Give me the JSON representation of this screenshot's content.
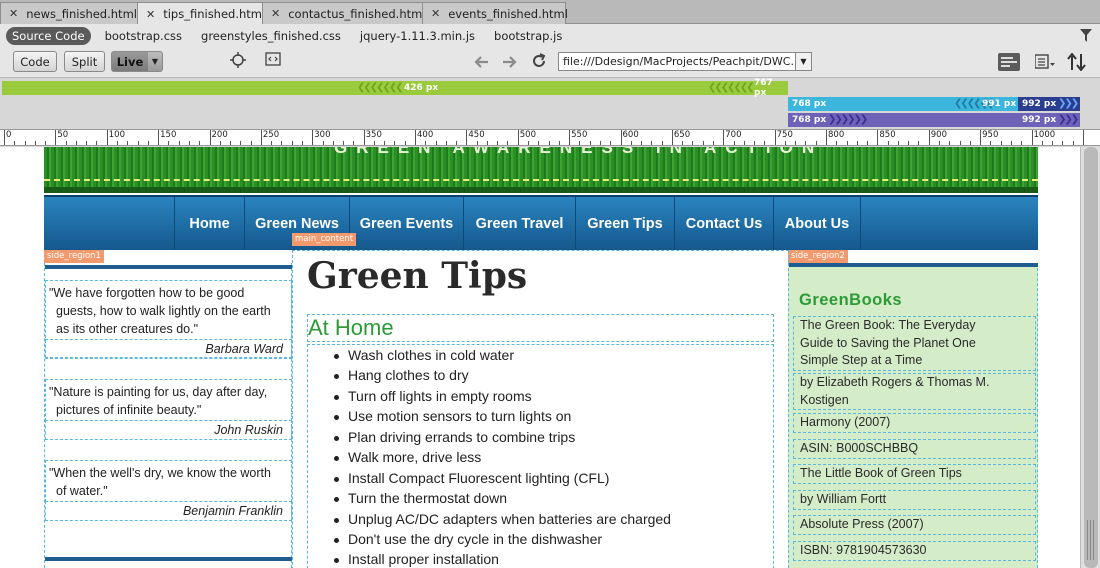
{
  "tabs": [
    {
      "label": "news_finished.html"
    },
    {
      "label": "tips_finished.html"
    },
    {
      "label": "contactus_finished.html"
    },
    {
      "label": "events_finished.html"
    }
  ],
  "related_files": {
    "source": "Source Code",
    "files": [
      "bootstrap.css",
      "greenstyles_finished.css",
      "jquery-1.11.3.min.js",
      "bootstrap.js"
    ]
  },
  "toolbar": {
    "code": "Code",
    "split": "Split",
    "live": "Live",
    "address": "file:///Ddesign/MacProjects/Peachpit/DWC..."
  },
  "media_queries": {
    "bar1_left": "426  px",
    "bar1_right": "767  px",
    "bar2_left": "768  px",
    "bar2_mid": "991  px",
    "bar2_right": "992  px",
    "bar3_left": "768  px",
    "bar3_right": "992  px"
  },
  "ruler": [
    "0",
    "50",
    "100",
    "150",
    "200",
    "250",
    "300",
    "350",
    "400",
    "450",
    "500",
    "550",
    "600",
    "650",
    "700",
    "750",
    "800",
    "850",
    "900",
    "950",
    "1000"
  ],
  "page": {
    "banner_title": "GREEN AWARENESS IN ACTION",
    "nav": [
      "Home",
      "Green News",
      "Green Events",
      "Green Travel",
      "Green Tips",
      "Contact Us",
      "About Us"
    ],
    "tags": {
      "main": "main_content",
      "side1": "side_region1",
      "side2": "side_region2"
    },
    "quotes": [
      {
        "l1": "\"We have forgotten how to be good",
        "l2": "guests, how to walk lightly on the earth",
        "l3": "as its other creatures do.\"",
        "author": "Barbara Ward"
      },
      {
        "l1": "\"Nature is painting for us, day after day,",
        "l2": "pictures of infinite beauty.\"",
        "author": "John Ruskin"
      },
      {
        "l1": "\"When the well's dry, we know the worth",
        "l2": "of water.\"",
        "author": "Benjamin Franklin"
      }
    ],
    "heading": "Green Tips",
    "subheading": "At Home",
    "tips": [
      "Wash clothes in cold water",
      "Hang clothes to dry",
      "Turn off lights in empty rooms",
      "Use motion sensors to turn lights on",
      "Plan driving errands to combine trips",
      "Walk more, drive less",
      "Install Compact Fluorescent lighting (CFL)",
      "Turn the thermostat down",
      "Unplug AC/DC adapters when batteries are charged",
      "Don't use the dry cycle in the dishwasher",
      "Install proper installation"
    ],
    "books_title": "GreenBooks",
    "books": [
      {
        "l1": "The Green Book: The Everyday",
        "l2": "Guide to Saving the Planet One",
        "l3": "Simple Step at a Time"
      },
      {
        "l1": "by Elizabeth Rogers & Thomas M.",
        "l2": "Kostigen"
      },
      {
        "l1": "Harmony (2007)"
      },
      {
        "l1": "ASIN: B000SCHBBQ"
      },
      {
        "l1": "The Little Book of Green Tips"
      },
      {
        "l1": "by William Fortt"
      },
      {
        "l1": "Absolute Press (2007)"
      },
      {
        "l1": "ISBN: 9781904573630"
      }
    ]
  },
  "colors": {
    "banner": "#2c8f26",
    "nav": "#1f6fa8",
    "green_text": "#2c9b37",
    "sidebar_bg": "#d5ecc9",
    "mq_green": "#9acb3c",
    "mq_cyan": "#3cb6dd",
    "mq_purple": "#6d62b8"
  }
}
